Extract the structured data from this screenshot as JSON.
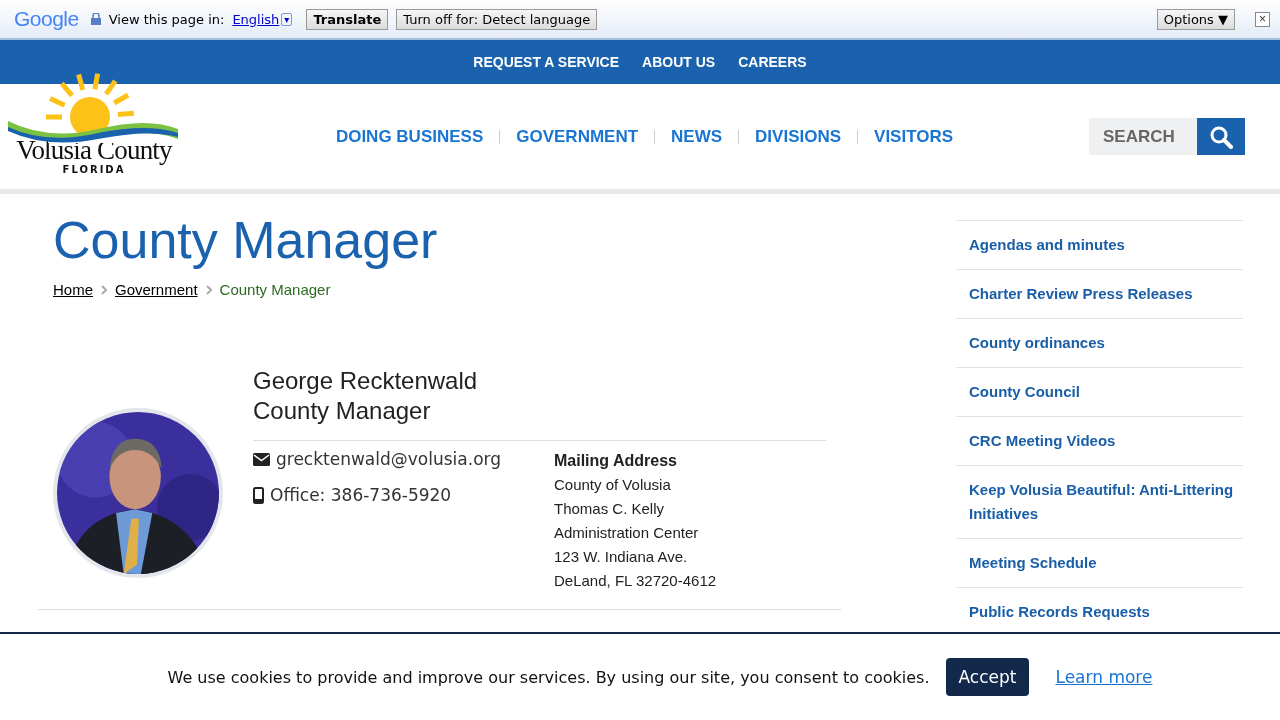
{
  "translate_bar": {
    "brand": "Google",
    "prompt": "View this page in:",
    "language": "English",
    "dropdown": "▾",
    "translate_button": "Translate",
    "turn_off_button": "Turn off for: Detect language",
    "options_button": "Options ▼",
    "close": "×"
  },
  "top_nav": [
    "REQUEST A SERVICE",
    "ABOUT US",
    "CAREERS"
  ],
  "logo": {
    "name": "Volusia County",
    "state": "FLORIDA"
  },
  "main_nav": [
    "DOING BUSINESS",
    "GOVERNMENT",
    "NEWS",
    "DIVISIONS",
    "VISITORS"
  ],
  "search": {
    "placeholder": "SEARCH"
  },
  "page_title": "County Manager",
  "breadcrumb": [
    {
      "label": "Home",
      "link": true
    },
    {
      "label": "Government",
      "link": true
    },
    {
      "label": "County Manager",
      "link": false
    }
  ],
  "profile": {
    "name": "George Recktenwald",
    "title": "County Manager",
    "email": "grecktenwald@volusia.org",
    "phone": "Office: 386-736-5920",
    "address_heading": "Mailing Address",
    "address_lines": [
      "County of Volusia",
      "Thomas C. Kelly",
      "Administration Center",
      "123 W. Indiana Ave.",
      "DeLand, FL 32720-4612"
    ]
  },
  "sidebar": [
    "Agendas and minutes",
    "Charter Review Press Releases",
    "County ordinances",
    "County Council",
    "CRC Meeting Videos",
    "Keep Volusia Beautiful: Anti-Littering Initiatives",
    "Meeting Schedule",
    "Public Records Requests"
  ],
  "cookie_banner": {
    "message": "We use cookies to provide and improve our services. By using our site, you consent to cookies.",
    "accept": "Accept",
    "learn_more": "Learn more"
  }
}
